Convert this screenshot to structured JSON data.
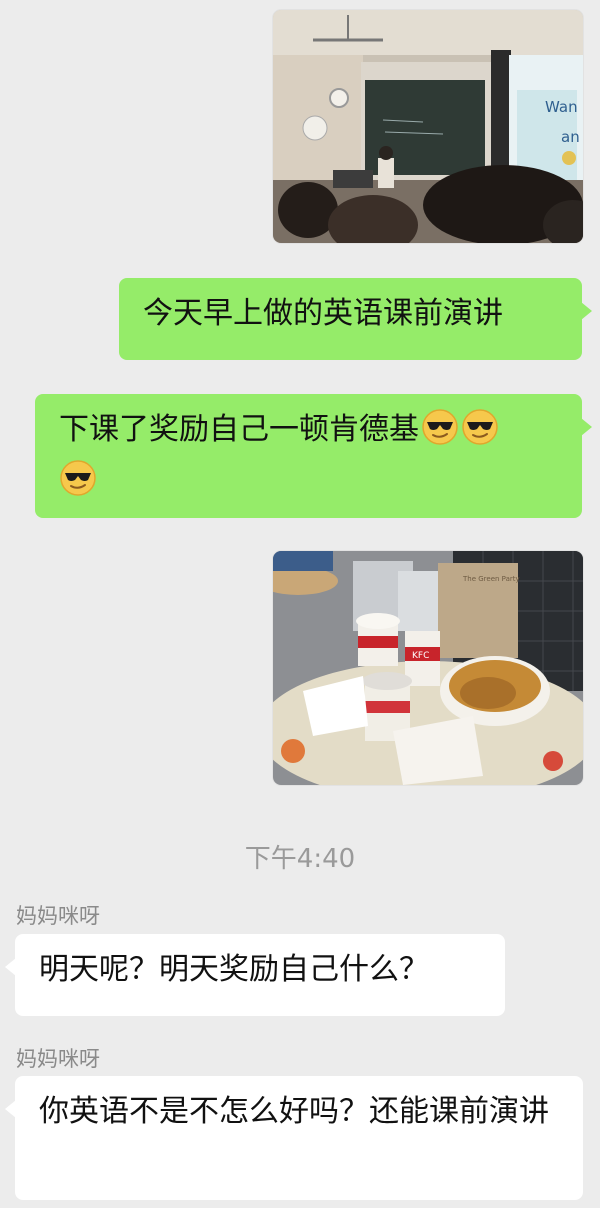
{
  "messages": {
    "sent_text_1": "今天早上做的英语课前演讲",
    "sent_text_2": "下课了奖励自己一顿肯德基",
    "emoji_name": "cool-sunglasses-emoji",
    "timestamp": "下午4:40",
    "received_1": {
      "sender": "妈妈咪呀",
      "text": "明天呢？明天奖励自己什么？"
    },
    "received_2": {
      "sender": "妈妈咪呀",
      "text": "你英语不是不怎么好吗？还能课前演讲"
    }
  },
  "colors": {
    "sent_bubble": "#95ec69",
    "received_bubble": "#ffffff",
    "background": "#ececec",
    "timestamp_text": "#9a9a9a"
  }
}
